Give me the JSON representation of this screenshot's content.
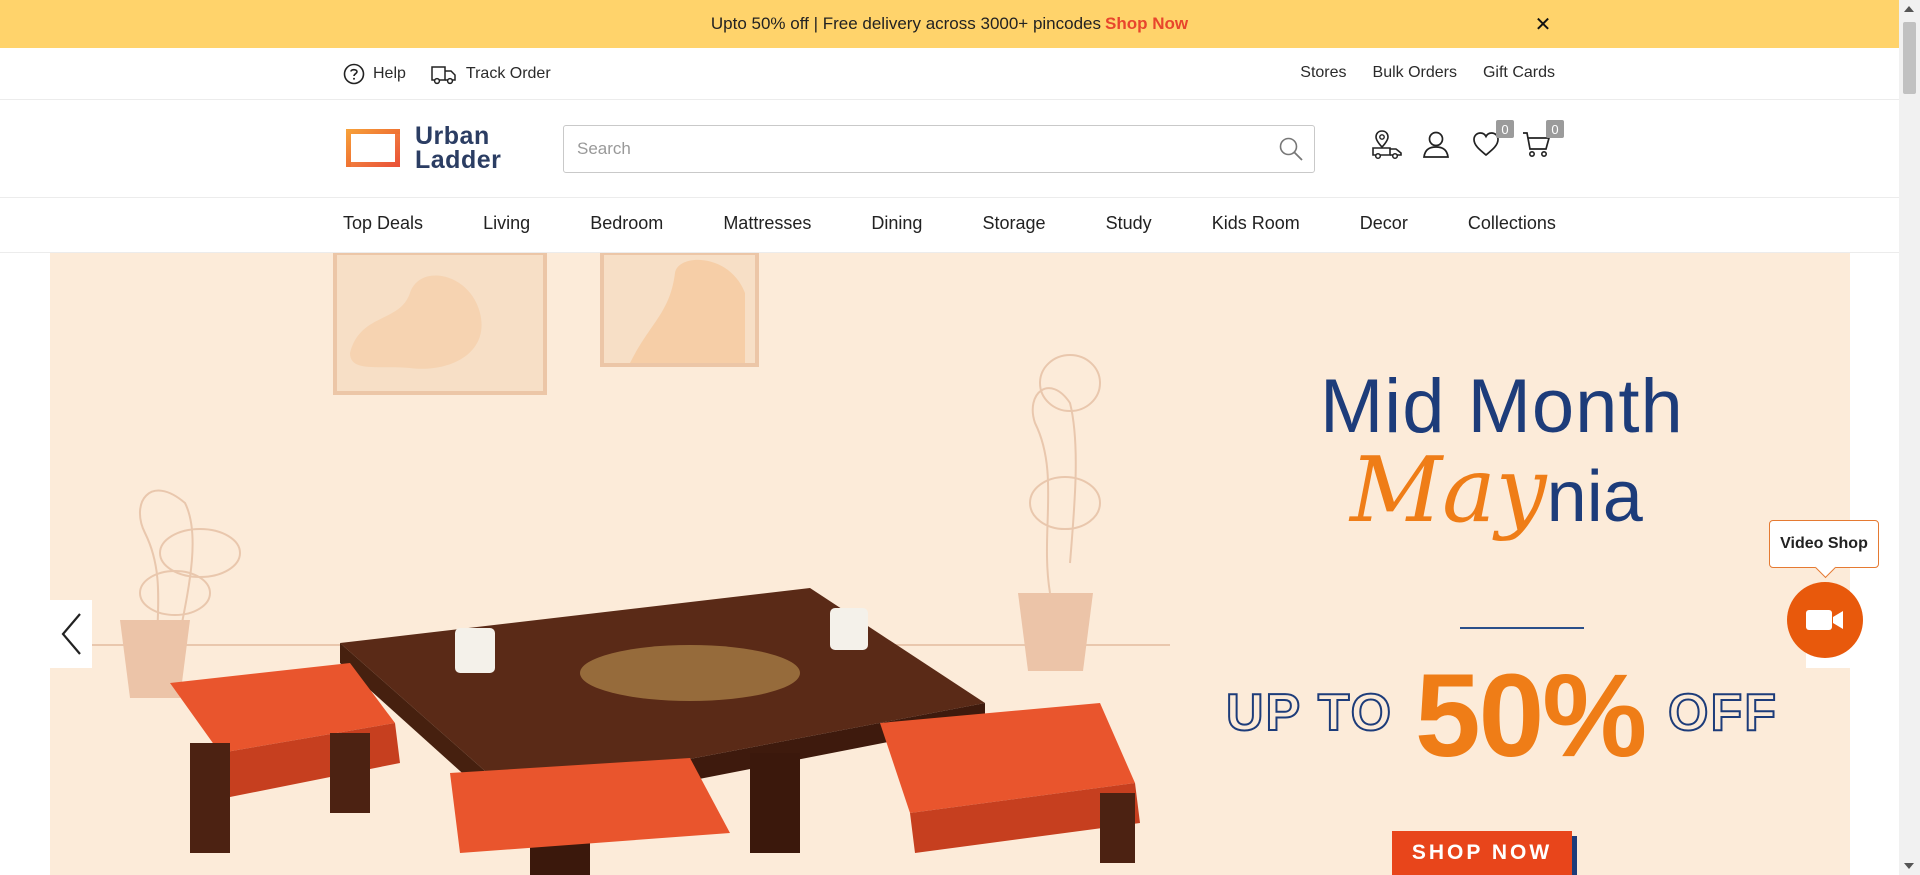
{
  "promo": {
    "text": "Upto 50% off | Free delivery across 3000+ pincodes",
    "link": "Shop Now",
    "close": "✕"
  },
  "utility": {
    "help": "Help",
    "track_order": "Track Order",
    "stores": "Stores",
    "bulk_orders": "Bulk Orders",
    "gift_cards": "Gift Cards"
  },
  "header": {
    "logo_line1": "Urban",
    "logo_line2": "Ladder",
    "search_placeholder": "Search",
    "wishlist_count": "0",
    "cart_count": "0"
  },
  "nav": {
    "items": [
      "Top Deals",
      "Living",
      "Bedroom",
      "Mattresses",
      "Dining",
      "Storage",
      "Study",
      "Kids Room",
      "Decor",
      "Collections"
    ]
  },
  "hero": {
    "line1": "Mid Month",
    "line2a": "May",
    "line2b": "nia",
    "upto": "UP TO",
    "percent": "50%",
    "off": "OFF",
    "cta": "SHOP NOW"
  },
  "video_shop": {
    "label": "Video Shop"
  },
  "colors": {
    "promo_bg": "#ffd36b",
    "accent": "#e8452c",
    "brand_orange": "#ef7d17",
    "brand_navy": "#1d3c7a",
    "hero_bg": "#fcebd9"
  }
}
